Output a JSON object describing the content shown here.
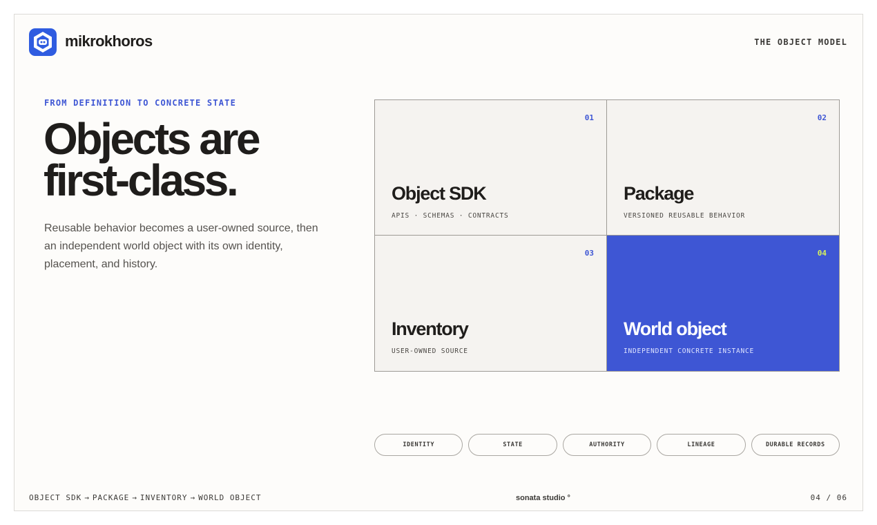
{
  "header": {
    "brand": "mikrokhoros",
    "section_label": "THE OBJECT MODEL",
    "logo_icon": "hexagon-robot-icon",
    "brand_color": "#2f5ce0"
  },
  "intro": {
    "eyebrow": "FROM DEFINITION TO CONCRETE STATE",
    "headline_line1": "Objects are",
    "headline_line2": "first-class.",
    "lede": "Reusable behavior becomes a user-owned source, then an independent world object with its own identity, placement, and history."
  },
  "grid": {
    "cells": [
      {
        "number": "01",
        "title": "Object SDK",
        "subtitle": "APIS · SCHEMAS · CONTRACTS"
      },
      {
        "number": "02",
        "title": "Package",
        "subtitle": "VERSIONED REUSABLE BEHAVIOR"
      },
      {
        "number": "03",
        "title": "Inventory",
        "subtitle": "USER-OWNED SOURCE"
      },
      {
        "number": "04",
        "title": "World object",
        "subtitle": "INDEPENDENT CONCRETE INSTANCE"
      }
    ],
    "accent_color": "#3e56d4",
    "highlight_number_color": "#d8f25a"
  },
  "pills": [
    "IDENTITY",
    "STATE",
    "AUTHORITY",
    "LINEAGE",
    "DURABLE RECORDS"
  ],
  "footer": {
    "path": [
      "OBJECT SDK",
      "PACKAGE",
      "INVENTORY",
      "WORLD OBJECT"
    ],
    "arrow": "→",
    "studio": "sonata studio °",
    "page": "04 / 06"
  }
}
